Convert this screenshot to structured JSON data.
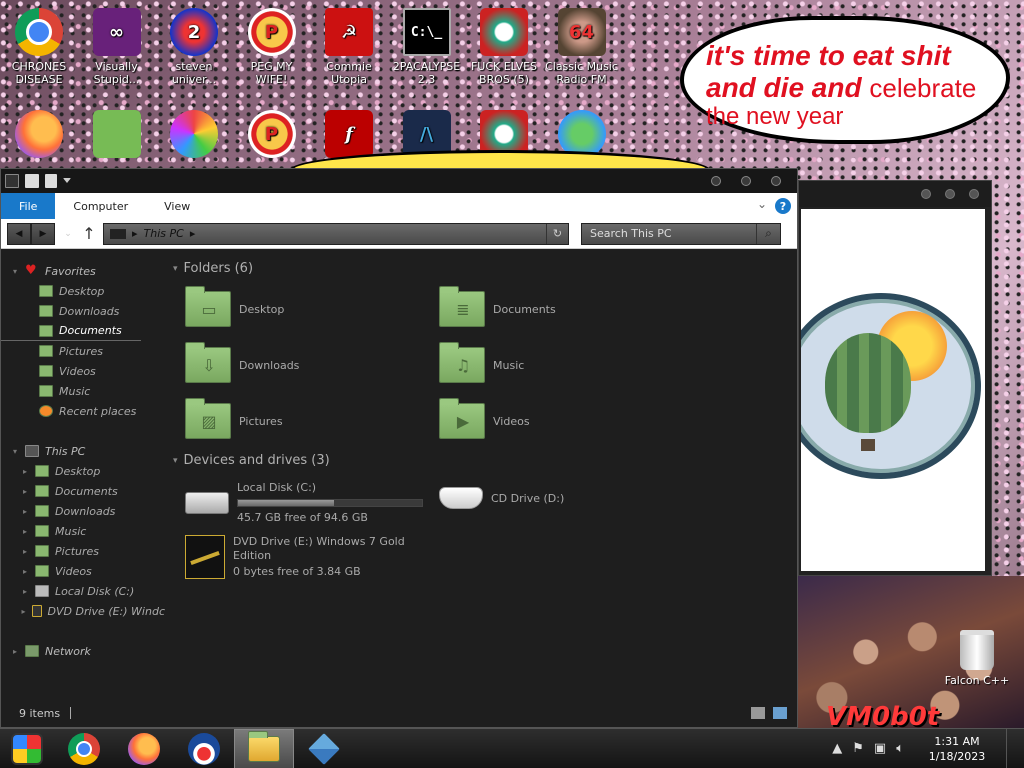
{
  "desktop": {
    "icons_row1": [
      {
        "label": "CHRONES DISEASE",
        "icon": "chrome-icon",
        "glyph": ""
      },
      {
        "label": "Visually Stupid...",
        "icon": "visual-studio-icon",
        "glyph": "∞"
      },
      {
        "label": "steven univer...",
        "icon": "steven-universe-icon",
        "glyph": "2"
      },
      {
        "label": "PEG MY WIFE!",
        "icon": "peggle-icon",
        "glyph": "P"
      },
      {
        "label": "Commie Utopia",
        "icon": "commie-icon",
        "glyph": "☭"
      },
      {
        "label": "2PACALYPSE 2.3",
        "icon": "cmd-icon",
        "glyph": "C:\\_"
      },
      {
        "label": "FUCK ELVES BROS (5)",
        "icon": "elves-icon",
        "glyph": ""
      },
      {
        "label": "Classic Music Radio FM",
        "icon": "radio-icon",
        "glyph": "64"
      }
    ],
    "icons_row2": [
      {
        "label": "",
        "icon": "firefox-icon",
        "glyph": ""
      },
      {
        "label": "",
        "icon": "angry-birds-icon",
        "glyph": ""
      },
      {
        "label": "",
        "icon": "gem-icon",
        "glyph": ""
      },
      {
        "label": "",
        "icon": "peggle-icon",
        "glyph": "P"
      },
      {
        "label": "",
        "icon": "flash-icon",
        "glyph": "f"
      },
      {
        "label": "",
        "icon": "notepad-icon",
        "glyph": "/\\"
      },
      {
        "label": "",
        "icon": "elves-icon",
        "glyph": ""
      },
      {
        "label": "",
        "icon": "msn-icon",
        "glyph": ""
      }
    ],
    "bubble": {
      "line1": "it's time to eat shit",
      "line2a": "and die and ",
      "line2b": "celebrate",
      "line3": "the new year"
    },
    "photo_caption": "VM0b0t",
    "trash_label": "Falcon C++"
  },
  "explorer": {
    "ribbon_tabs": [
      "File",
      "Computer",
      "View"
    ],
    "address": "This PC",
    "search_placeholder": "Search This PC",
    "nav": {
      "favorites_label": "Favorites",
      "favorites": [
        "Desktop",
        "Downloads",
        "Documents",
        "Pictures",
        "Videos",
        "Music",
        "Recent places"
      ],
      "thispc_label": "This PC",
      "thispc": [
        "Desktop",
        "Documents",
        "Downloads",
        "Music",
        "Pictures",
        "Videos",
        "Local Disk (C:)",
        "DVD Drive (E:) Windc"
      ],
      "network_label": "Network"
    },
    "folders_header": "Folders (6)",
    "folders": [
      "Desktop",
      "Documents",
      "Downloads",
      "Music",
      "Pictures",
      "Videos"
    ],
    "devices_header": "Devices and drives (3)",
    "drives": [
      {
        "name": "Local Disk (C:)",
        "free": "45.7 GB free of 94.6 GB",
        "used_fraction": 0.52
      },
      {
        "name": "CD Drive (D:)"
      },
      {
        "name": "DVD Drive (E:) Windows 7 Gold Edition",
        "free": "0 bytes free of 3.84 GB"
      }
    ],
    "status": "9 items"
  },
  "taskbar": {
    "time": "1:31 AM",
    "date": "1/18/2023",
    "tray_expand": "▲"
  }
}
